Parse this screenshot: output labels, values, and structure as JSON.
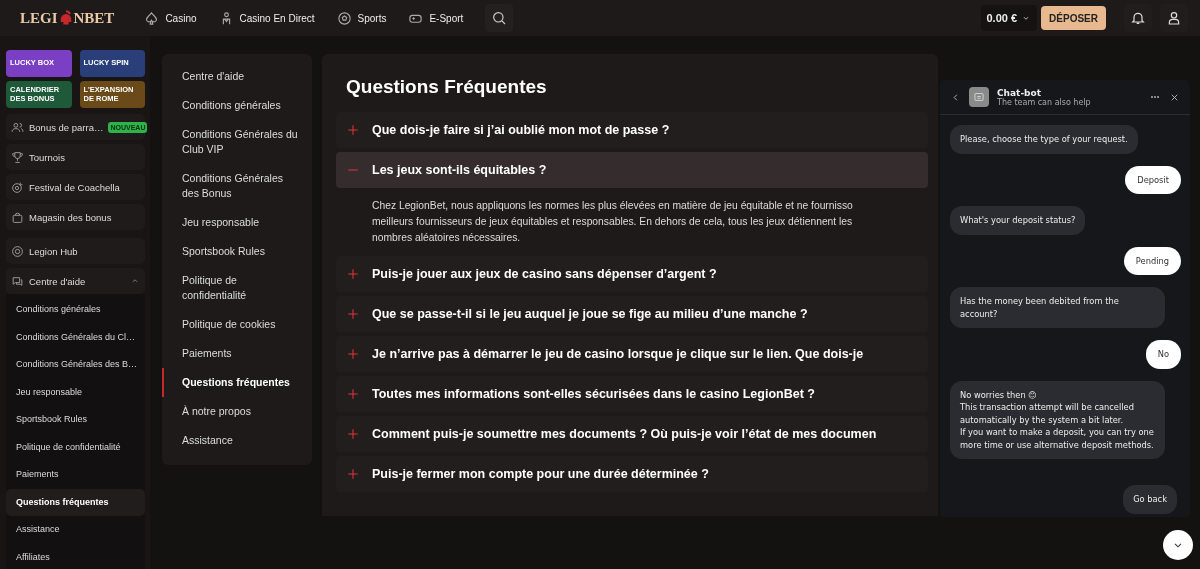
{
  "topbar": {
    "logo": {
      "before": "LEGI",
      "after": "NBET"
    },
    "nav": [
      {
        "kind": "spade",
        "label": "Casino"
      },
      {
        "kind": "dealer",
        "label": "Casino En Direct"
      },
      {
        "kind": "ball",
        "label": "Sports"
      },
      {
        "kind": "gamepad",
        "label": "E-Sport"
      }
    ],
    "balance": "0.00 €",
    "deposit": "DÉPOSER"
  },
  "sidebar": {
    "promos": [
      {
        "label": "LUCKY BOX",
        "color": "#7b3fc4"
      },
      {
        "label": "LUCKY SPIN",
        "color": "#2a3f7a"
      },
      {
        "label": "CALENDRIER DES BONUS",
        "color": "#1e5a3a"
      },
      {
        "label": "L'EXPANSION DE ROME",
        "color": "#6b4a1a"
      }
    ],
    "items": [
      {
        "kind": "people",
        "label": "Bonus de parra…",
        "badge": "NOUVEAU"
      },
      {
        "kind": "trophy",
        "label": "Tournois"
      },
      {
        "kind": "target",
        "label": "Festival de Coachella"
      },
      {
        "kind": "bag",
        "label": "Magasin des bonus"
      },
      {
        "kind": "hub",
        "label": "Legion Hub"
      },
      {
        "kind": "help",
        "label": "Centre d'aide",
        "expanded": true,
        "children": [
          {
            "label": "Conditions générales",
            "selected": false
          },
          {
            "label": "Conditions Générales du Cl…",
            "selected": false
          },
          {
            "label": "Conditions Générales des B…",
            "selected": false
          },
          {
            "label": "Jeu responsable",
            "selected": false
          },
          {
            "label": "Sportsbook Rules",
            "selected": false
          },
          {
            "label": "Politique de confidentialité",
            "selected": false
          },
          {
            "label": "Paiements",
            "selected": false
          },
          {
            "label": "Questions fréquentes",
            "selected": true
          },
          {
            "label": "Assistance",
            "selected": false
          },
          {
            "label": "Affiliates",
            "selected": false
          }
        ]
      }
    ]
  },
  "help_nav": [
    {
      "label": "Centre d'aide",
      "selected": false
    },
    {
      "label": "Conditions générales",
      "selected": false
    },
    {
      "label": "Conditions Générales du Club VIP",
      "selected": false
    },
    {
      "label": "Conditions Générales des Bonus",
      "selected": false
    },
    {
      "label": "Jeu responsable",
      "selected": false
    },
    {
      "label": "Sportsbook Rules",
      "selected": false
    },
    {
      "label": "Politique de confidentialité",
      "selected": false
    },
    {
      "label": "Politique de cookies",
      "selected": false
    },
    {
      "label": "Paiements",
      "selected": false
    },
    {
      "label": "Questions fréquentes",
      "selected": true
    },
    {
      "label": "À notre propos",
      "selected": false
    },
    {
      "label": "Assistance",
      "selected": false
    }
  ],
  "faq": {
    "title": "Questions Fréquentes",
    "items": [
      {
        "question": "Que dois-je faire si j’ai oublié mon mot de passe ?",
        "expanded": false
      },
      {
        "question": "Les jeux sont-ils équitables ?",
        "expanded": true,
        "answer": [
          "Chez LegionBet, nous appliquons les normes les plus élevées en matière de jeu équitable et ne fournisso",
          "meilleurs fournisseurs de jeux équitables et responsables. En dehors de cela, tous les jeux détiennent les",
          "nombres aléatoires nécessaires."
        ]
      },
      {
        "question": "Puis-je jouer aux jeux de casino sans dépenser d’argent ?",
        "expanded": false
      },
      {
        "question": "Que se passe-t-il si le jeu auquel je joue se fige au milieu d’une manche ?",
        "expanded": false
      },
      {
        "question": "Je n’arrive pas à démarrer le jeu de casino lorsque je clique sur le lien. Que dois-je",
        "expanded": false
      },
      {
        "question": "Toutes mes informations sont-elles sécurisées dans le casino LegionBet ?",
        "expanded": false
      },
      {
        "question": "Comment puis-je soumettre mes documents ? Où puis-je voir l’état de mes documen",
        "expanded": false
      },
      {
        "question": "Puis-je fermer mon compte pour une durée déterminée ?",
        "expanded": false
      }
    ]
  },
  "chat": {
    "title": "Chat-bot",
    "subtitle": "The team can also help",
    "messages": [
      {
        "kind": "bot",
        "lines": [
          "Please, choose the type of your request."
        ]
      },
      {
        "kind": "user",
        "lines": [
          "Deposit"
        ]
      },
      {
        "kind": "bot",
        "lines": [
          "What's your deposit status?"
        ]
      },
      {
        "kind": "user",
        "lines": [
          "Pending"
        ]
      },
      {
        "kind": "bot",
        "lines": [
          "Has the money been debited from the account?"
        ]
      },
      {
        "kind": "user",
        "lines": [
          "No"
        ]
      },
      {
        "kind": "bot",
        "lines": [
          "No worries then 😊",
          "This transaction attempt will be cancelled automatically by the system a bit later.",
          "If you want to make a deposit, you can try one more time or use alternative deposit methods."
        ]
      },
      {
        "kind": "action",
        "lines": [
          "Go back"
        ]
      }
    ]
  }
}
